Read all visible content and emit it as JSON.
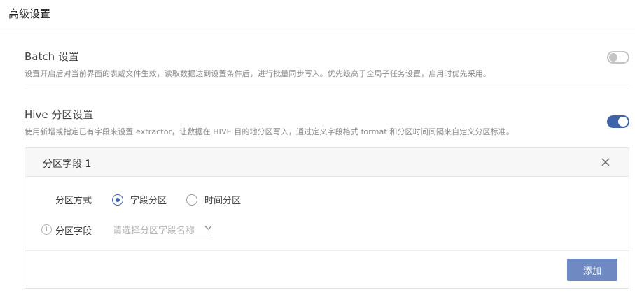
{
  "page": {
    "title": "高级设置"
  },
  "batch": {
    "title": "Batch 设置",
    "description": "设置开启后对当前界面的表或文件生效，读取数据达到设置条件后，进行批量同步写入。优先级高于全局子任务设置，启用时优先采用。",
    "enabled": false
  },
  "hive": {
    "title": "Hive 分区设置",
    "description": "使用新增或指定已有字段来设置 extractor，让数据在 HIVE 目的地分区写入，通过定义字段格式 format 和分区时间间隔来自定义分区标准。",
    "enabled": true
  },
  "partition_card": {
    "title": "分区字段 1",
    "mode_label": "分区方式",
    "mode_options": [
      {
        "label": "字段分区",
        "checked": true
      },
      {
        "label": "时间分区",
        "checked": false
      }
    ],
    "field_label": "分区字段",
    "field_placeholder": "请选择分区字段名称",
    "add_label": "添加"
  },
  "colors": {
    "accent": "#3f63a8",
    "button": "#6f8ac2",
    "toggle_off": "#c4c4c4"
  },
  "icons": [
    "close-icon",
    "info-icon",
    "chevron-down-icon"
  ]
}
